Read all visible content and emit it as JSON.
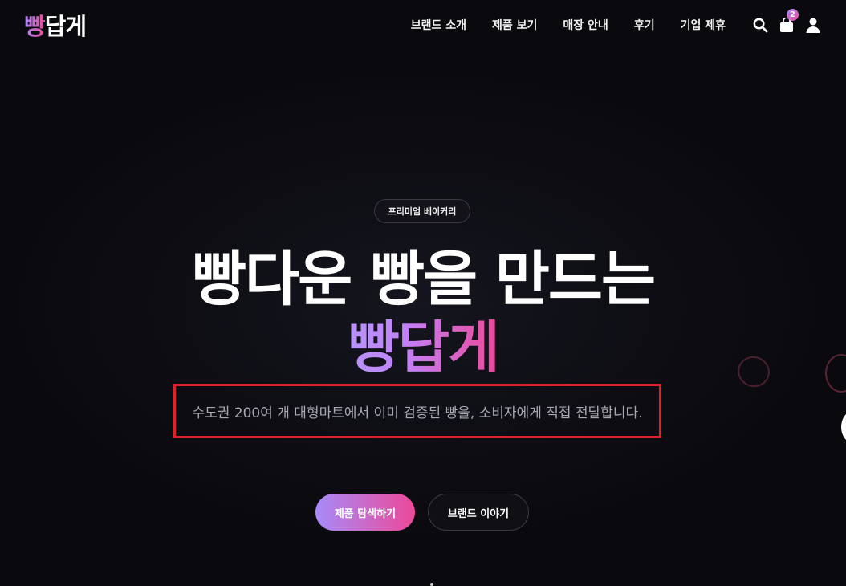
{
  "header": {
    "logo_accent": "빵",
    "logo_rest": "답게",
    "nav": [
      {
        "label": "브랜드 소개"
      },
      {
        "label": "제품 보기"
      },
      {
        "label": "매장 안내"
      },
      {
        "label": "후기"
      },
      {
        "label": "기업 제휴"
      }
    ],
    "icons": [
      "search-icon",
      "cart-icon",
      "user-icon"
    ],
    "cart_count": "2"
  },
  "hero": {
    "tag": "프리미엄 베이커리",
    "headline": "빵다운 빵을 만드는",
    "brand": "빵답게",
    "subtitle": "수도권 200여 개 대형마트에서 이미 검증된 빵을, 소비자에게 직접 전달합니다.",
    "primary_button": "제품 탐색하기",
    "secondary_button": "브랜드 이야기"
  },
  "colors": {
    "accent_start": "#a78bfa",
    "accent_end": "#ec4899",
    "background": "#0b0b10",
    "highlight_box": "#e0202a"
  }
}
